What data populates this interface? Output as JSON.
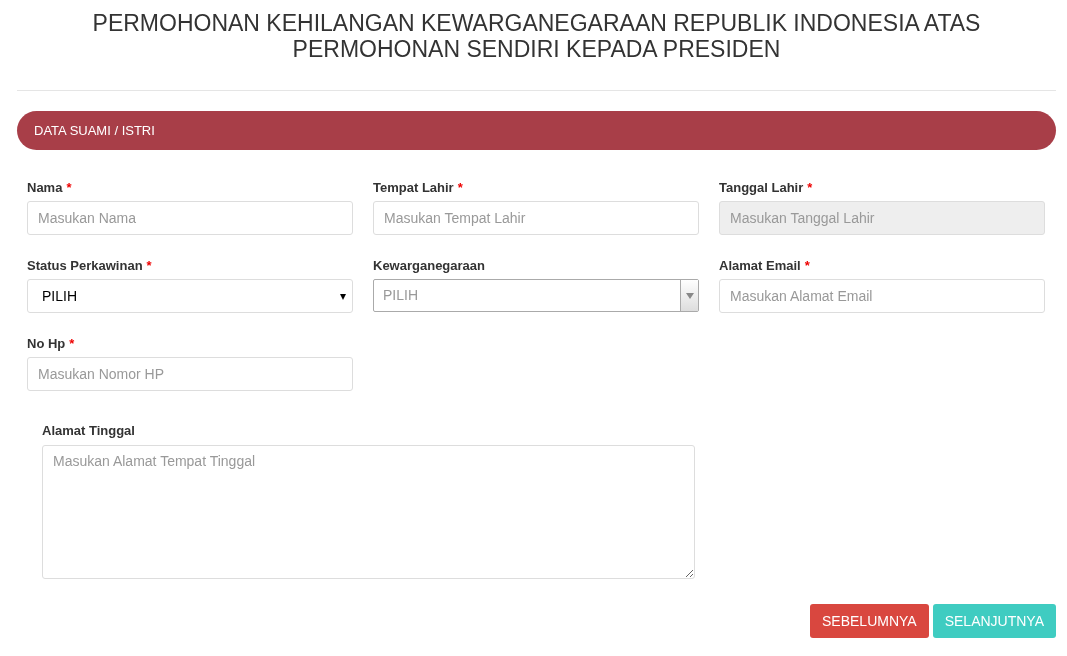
{
  "title": "PERMOHONAN KEHILANGAN KEWARGANEGARAAN REPUBLIK INDONESIA ATAS PERMOHONAN SENDIRI KEPADA PRESIDEN",
  "section": {
    "title": "DATA SUAMI / ISTRI"
  },
  "fields": [
    {
      "label": "Nama",
      "required_mark": "*",
      "kind": "text",
      "placeholder": "Masukan Nama",
      "disabled": false
    },
    {
      "label": "Tempat Lahir",
      "required_mark": "*",
      "kind": "text",
      "placeholder": "Masukan Tempat Lahir",
      "disabled": false
    },
    {
      "label": "Tanggal Lahir",
      "required_mark": "*",
      "kind": "text",
      "placeholder": "Masukan Tanggal Lahir",
      "disabled": true
    },
    {
      "label": "Status Perkawinan",
      "required_mark": "*",
      "kind": "select",
      "value": "PILIH",
      "caret": "▾"
    },
    {
      "label": "Kewarganegaraan",
      "kind": "combo",
      "value": "PILIH"
    },
    {
      "label": "Alamat Email",
      "required_mark": "*",
      "kind": "text",
      "placeholder": "Masukan Alamat Email",
      "disabled": false
    },
    {
      "label": "No Hp",
      "required_mark": "*",
      "kind": "text",
      "placeholder": "Masukan Nomor HP",
      "disabled": false
    }
  ],
  "address": {
    "label": "Alamat Tinggal",
    "placeholder": "Masukan Alamat Tempat Tinggal"
  },
  "buttons": [
    {
      "label": "SEBELUMNYA",
      "kind": "back"
    },
    {
      "label": "SELANJUTNYA",
      "kind": "next"
    }
  ]
}
